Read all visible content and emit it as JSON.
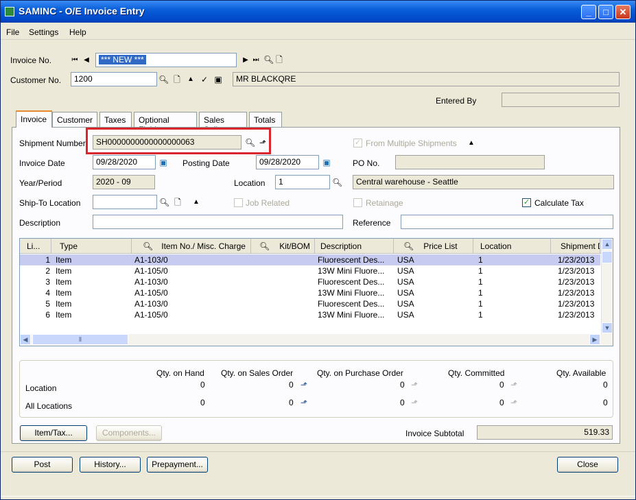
{
  "window": {
    "title": "SAMINC - O/E Invoice Entry",
    "controls": [
      "_",
      "□",
      "✕"
    ]
  },
  "menu": [
    "File",
    "Settings",
    "Help"
  ],
  "header": {
    "invoice_no_label": "Invoice No.",
    "invoice_no_value": "*** NEW ***",
    "customer_no_label": "Customer No.",
    "customer_no_value": "1200",
    "customer_name": "MR BLACKQRE",
    "entered_by_label": "Entered By",
    "entered_by_value": ""
  },
  "tabs": [
    "Invoice",
    "Customer",
    "Taxes",
    "Optional Fields",
    "Sales Split",
    "Totals"
  ],
  "invoice_tab": {
    "shipment_number_label": "Shipment Number",
    "shipment_number_value": "SH0000000000000000063",
    "from_multiple_shipments_label": "From Multiple Shipments",
    "invoice_date_label": "Invoice Date",
    "invoice_date_value": "09/28/2020",
    "posting_date_label": "Posting Date",
    "posting_date_value": "09/28/2020",
    "po_no_label": "PO No.",
    "po_no_value": "",
    "year_period_label": "Year/Period",
    "year_period_value": "2020 - 09",
    "location_label": "Location",
    "location_value": "1",
    "location_desc": "Central warehouse - Seattle",
    "ship_to_label": "Ship-To Location",
    "ship_to_value": "",
    "job_related_label": "Job Related",
    "retainage_label": "Retainage",
    "calculate_tax_label": "Calculate Tax",
    "description_label": "Description",
    "description_value": "",
    "reference_label": "Reference",
    "reference_value": ""
  },
  "grid": {
    "columns": [
      "Li...",
      "Type",
      "Item No./ Misc. Charge",
      "Kit/BOM",
      "Description",
      "Price List",
      "Location",
      "Shipment D"
    ],
    "rows": [
      {
        "line": "1",
        "type": "Item",
        "item": "A1-103/0",
        "kit": "",
        "desc": "Fluorescent Des...",
        "price_list": "USA",
        "location": "1",
        "ship_date": "1/23/2013"
      },
      {
        "line": "2",
        "type": "Item",
        "item": "A1-105/0",
        "kit": "",
        "desc": "13W Mini Fluore...",
        "price_list": "USA",
        "location": "1",
        "ship_date": "1/23/2013"
      },
      {
        "line": "3",
        "type": "Item",
        "item": "A1-103/0",
        "kit": "",
        "desc": "Fluorescent Des...",
        "price_list": "USA",
        "location": "1",
        "ship_date": "1/23/2013"
      },
      {
        "line": "4",
        "type": "Item",
        "item": "A1-105/0",
        "kit": "",
        "desc": "13W Mini Fluore...",
        "price_list": "USA",
        "location": "1",
        "ship_date": "1/23/2013"
      },
      {
        "line": "5",
        "type": "Item",
        "item": "A1-103/0",
        "kit": "",
        "desc": "Fluorescent Des...",
        "price_list": "USA",
        "location": "1",
        "ship_date": "1/23/2013"
      },
      {
        "line": "6",
        "type": "Item",
        "item": "A1-105/0",
        "kit": "",
        "desc": "13W Mini Fluore...",
        "price_list": "USA",
        "location": "1",
        "ship_date": "1/23/2013"
      }
    ]
  },
  "quantities": {
    "headers": [
      "Qty. on Hand",
      "Qty. on Sales Order",
      "Qty. on Purchase Order",
      "Qty. Committed",
      "Qty. Available"
    ],
    "location_label": "Location",
    "all_locations_label": "All Locations",
    "location_values": [
      "0",
      "0",
      "0",
      "0",
      "0"
    ],
    "all_locations_values": [
      "0",
      "0",
      "0",
      "0",
      "0"
    ]
  },
  "buttons": {
    "item_tax": "Item/Tax...",
    "components": "Components...",
    "post": "Post",
    "history": "History...",
    "prepayment": "Prepayment...",
    "close": "Close"
  },
  "subtotal": {
    "label": "Invoice Subtotal",
    "value": "519.33"
  }
}
